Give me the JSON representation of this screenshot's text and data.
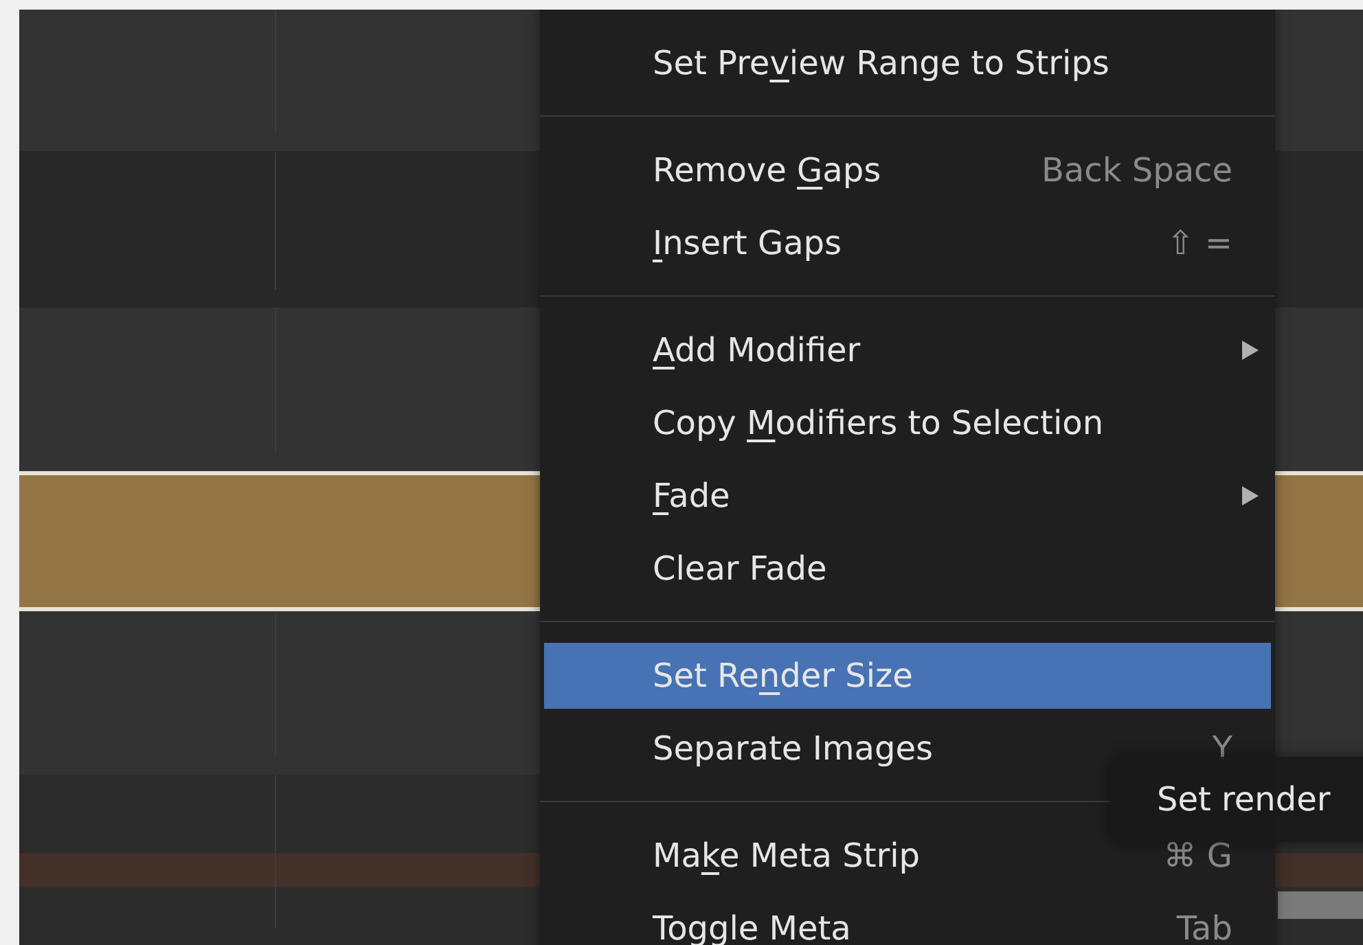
{
  "timeline": {
    "tracks": [
      {
        "kind": "light"
      },
      {
        "kind": "dark"
      },
      {
        "kind": "light"
      },
      {
        "kind": "strip",
        "color": "#937545"
      },
      {
        "kind": "light"
      },
      {
        "kind": "meta"
      }
    ]
  },
  "context_menu": {
    "items": [
      {
        "kind": "item",
        "label_parts": {
          "before": "Set Pre",
          "mnemonic": "v",
          "after": "iew Range to Strips"
        },
        "selected": false,
        "submenu": false
      },
      {
        "kind": "separator"
      },
      {
        "kind": "item",
        "label_parts": {
          "before": "Remove ",
          "mnemonic": "G",
          "after": "aps"
        },
        "shortcut": "Back Space",
        "selected": false,
        "submenu": false
      },
      {
        "kind": "item",
        "label_parts": {
          "mnemonic": "I",
          "after": "nsert Gaps"
        },
        "shortcut": "⇧ =",
        "selected": false,
        "submenu": false
      },
      {
        "kind": "separator"
      },
      {
        "kind": "item",
        "label_parts": {
          "mnemonic": "A",
          "after": "dd Modifier"
        },
        "selected": false,
        "submenu": true
      },
      {
        "kind": "item",
        "label_parts": {
          "before": "Copy ",
          "mnemonic": "M",
          "after": "odifiers to Selection"
        },
        "selected": false,
        "submenu": false
      },
      {
        "kind": "item",
        "label_parts": {
          "mnemonic": "F",
          "after": "ade"
        },
        "selected": false,
        "submenu": true
      },
      {
        "kind": "item",
        "label_parts": {
          "before": "Clear Fade"
        },
        "selected": false,
        "submenu": false
      },
      {
        "kind": "separator"
      },
      {
        "kind": "item",
        "label_parts": {
          "before": "Set Re",
          "mnemonic": "n",
          "after": "der Size"
        },
        "selected": true,
        "submenu": false
      },
      {
        "kind": "item",
        "label_parts": {
          "before": "Separate Images"
        },
        "shortcut": "Y",
        "selected": false,
        "submenu": false
      },
      {
        "kind": "separator"
      },
      {
        "kind": "item",
        "label_parts": {
          "before": "Ma",
          "mnemonic": "k",
          "after": "e Meta Strip"
        },
        "shortcut": "⌘ G",
        "selected": false,
        "submenu": false
      },
      {
        "kind": "item",
        "label_parts": {
          "before": "Toggle Meta"
        },
        "shortcut": "Tab",
        "selected": false,
        "submenu": false
      }
    ]
  },
  "tooltip": {
    "text": "Set render"
  }
}
